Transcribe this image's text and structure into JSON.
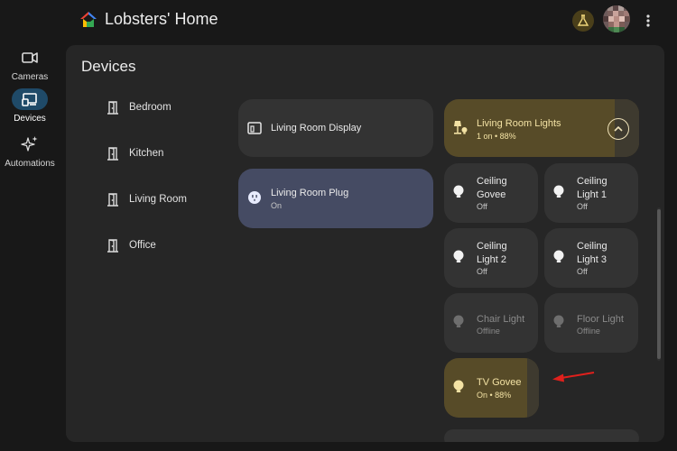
{
  "header": {
    "home_title": "Lobsters' Home"
  },
  "nav": {
    "items": [
      {
        "label": "Cameras",
        "icon": "camera-icon"
      },
      {
        "label": "Devices",
        "icon": "devices-icon",
        "active": true
      },
      {
        "label": "Automations",
        "icon": "sparkle-icon"
      }
    ]
  },
  "main": {
    "title": "Devices",
    "rooms": [
      "Bedroom",
      "Kitchen",
      "Living Room",
      "Office"
    ],
    "devices": {
      "display": {
        "name": "Living Room Display"
      },
      "plug": {
        "name": "Living Room Plug",
        "status": "On"
      },
      "lights_group": {
        "name": "Living Room Lights",
        "status": "1 on • 88%"
      },
      "lights": [
        {
          "name": "Ceiling Govee",
          "status": "Off"
        },
        {
          "name": "Ceiling Light 1",
          "status": "Off"
        },
        {
          "name": "Ceiling Light 2",
          "status": "Off"
        },
        {
          "name": "Ceiling Light 3",
          "status": "Off"
        },
        {
          "name": "Chair Light",
          "status": "Offline"
        },
        {
          "name": "Floor Light",
          "status": "Offline"
        },
        {
          "name": "TV Govee",
          "status": "On • 88%"
        }
      ]
    }
  },
  "colors": {
    "background": "#181818",
    "panel": "#262626",
    "card": "#333333",
    "plug_on": "#454b63",
    "light_on": "#574b28",
    "light_on_text": "#f3e2a4",
    "nav_active": "#1f4a68",
    "annotation_arrow": "#e0201c"
  }
}
